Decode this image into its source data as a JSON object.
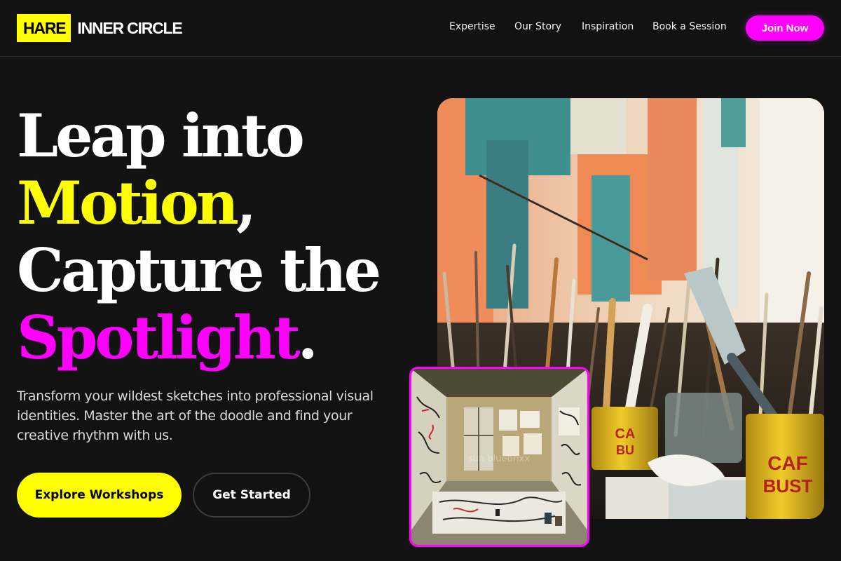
{
  "brand": {
    "badge": "HARE",
    "name": "INNER CIRCLE",
    "badge_color": "#ffff00"
  },
  "nav": {
    "items": [
      {
        "label": "Expertise"
      },
      {
        "label": "Our Story"
      },
      {
        "label": "Inspiration"
      },
      {
        "label": "Book a Session"
      }
    ],
    "cta_label": "Join Now"
  },
  "hero": {
    "headline": {
      "line1": "Leap into",
      "line2_highlight": "Motion",
      "line2_punct": ",",
      "line3": "Capture the",
      "line4_highlight": "Spotlight",
      "line4_punct": "."
    },
    "lede": "Transform your wildest sketches into professional visual identities. Master the art of the doodle and find your creative rhythm with us.",
    "primary_cta": "Explore Workshops",
    "secondary_cta": "Get Started"
  },
  "images": {
    "main_icon": "paintbrushes-in-cans-photo",
    "inset_icon": "doodled-art-studio-room-photo",
    "inset_watermark": "sun bluebrixx"
  },
  "colors": {
    "accent_yellow": "#ffff00",
    "accent_magenta": "#ff00ff",
    "background": "#121212"
  }
}
